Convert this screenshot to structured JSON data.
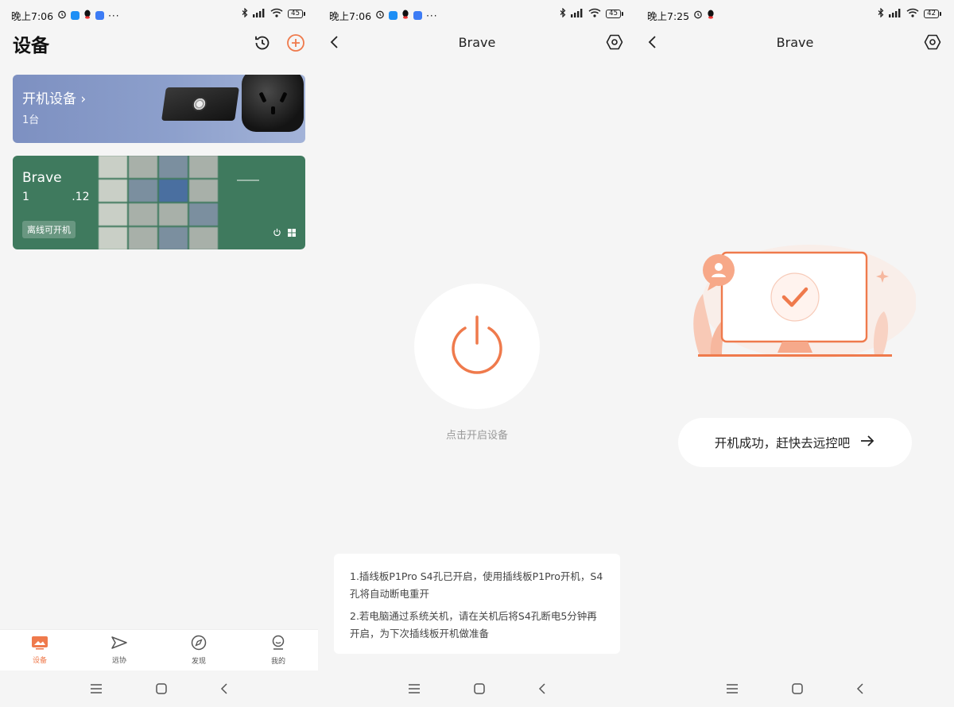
{
  "screens": [
    {
      "status": {
        "time": "晚上7:06",
        "dots": "···",
        "battery": "45"
      },
      "title": "设备",
      "devices_card": {
        "title": "开机设备",
        "chevron": "›",
        "count": "1台"
      },
      "brave_card": {
        "name": "Brave",
        "ip": "1            .12",
        "badge": "离线可开机"
      },
      "tabs": [
        {
          "label": "设备",
          "icon": "devices-icon",
          "active": true
        },
        {
          "label": "远协",
          "icon": "remote-assist-icon",
          "active": false
        },
        {
          "label": "发现",
          "icon": "compass-icon",
          "active": false
        },
        {
          "label": "我的",
          "icon": "profile-icon",
          "active": false
        }
      ]
    },
    {
      "status": {
        "time": "晚上7:06",
        "dots": "···",
        "battery": "45"
      },
      "title": "Brave",
      "tap_label": "点击开启设备",
      "notes": [
        "1.插线板P1Pro S4孔已开启，使用插线板P1Pro开机，S4孔将自动断电重开",
        "2.若电脑通过系统关机，请在关机后将S4孔断电5分钟再开启，为下次插线板开机做准备"
      ]
    },
    {
      "status": {
        "time": "晚上7:25",
        "battery": "42"
      },
      "title": "Brave",
      "success_text": "开机成功，赶快去远控吧",
      "arrow": "→"
    }
  ],
  "colors": {
    "accent": "#ef7a4c",
    "brave_card": "#3f7a5e",
    "devices_card": "#8a9dca"
  }
}
